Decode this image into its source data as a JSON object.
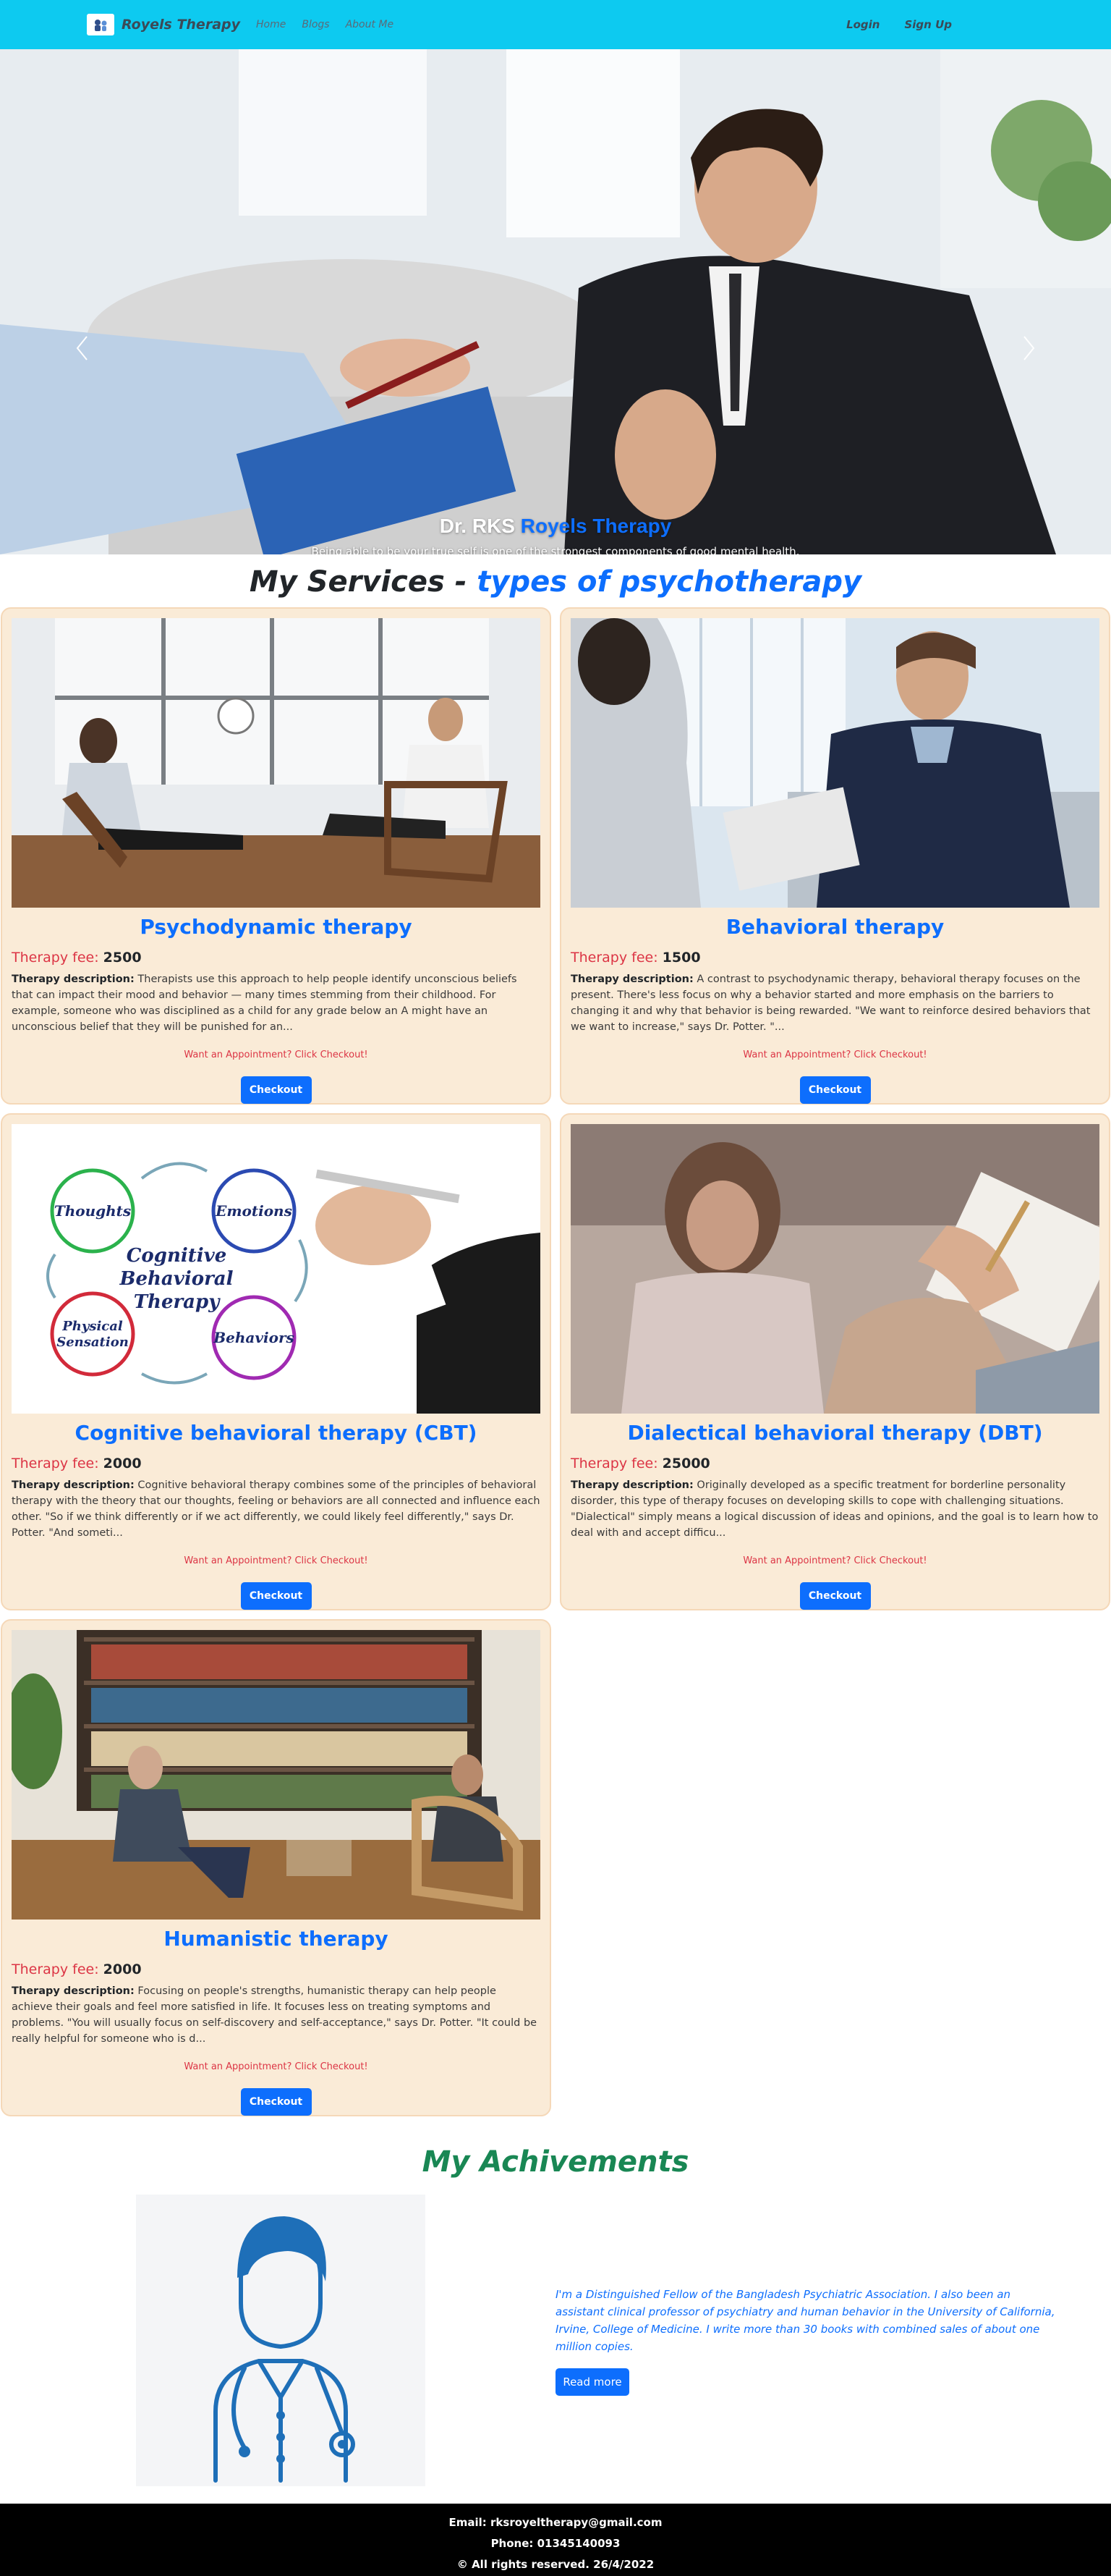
{
  "navbar": {
    "brand": "Royels Therapy",
    "links": [
      "Home",
      "Blogs",
      "About Me"
    ],
    "login": "Login",
    "signup": "Sign Up"
  },
  "carousel": {
    "caption_prefix": "Dr. RKS",
    "caption_accent": "Royels Therapy",
    "caption_text": "Being able to be your true self is one of the strongest components of good mental health.",
    "prev_icon": "chevron-left-icon",
    "next_icon": "chevron-right-icon",
    "active_slide": 2,
    "slide_count": 3
  },
  "services": {
    "title": "My Services -",
    "title_accent": "types of psychotherapy",
    "fee_label": "Therapy fee:",
    "desc_label": "Therapy description:",
    "appointment_text": "Want an Appointment? Click Checkout!",
    "checkout_label": "Checkout",
    "items": [
      {
        "title": "Psychodynamic therapy",
        "fee": "2500",
        "description": "Therapists use this approach to help people identify unconscious beliefs that can impact their mood and behavior — many times stemming from their childhood. For example, someone who was disciplined as a child for any grade below an A might have an unconscious belief that they will be punished for an..."
      },
      {
        "title": "Behavioral therapy",
        "fee": "1500",
        "description": "A contrast to psychodynamic therapy, behavioral therapy focuses on the present. There's less focus on why a behavior started and more emphasis on the barriers to changing it and why that behavior is being rewarded. \"We want to reinforce desired behaviors that we want to increase,\" says Dr. Potter. \"..."
      },
      {
        "title": "Cognitive behavioral therapy (CBT)",
        "fee": "2000",
        "description": "Cognitive behavioral therapy combines some of the principles of behavioral therapy with the theory that our thoughts, feeling or behaviors are all connected and influence each other. \"So if we think differently or if we act differently, we could likely feel differently,\" says Dr. Potter. \"And someti..."
      },
      {
        "title": "Dialectical behavioral therapy (DBT)",
        "fee": "25000",
        "description": "Originally developed as a specific treatment for borderline personality disorder, this type of therapy focuses on developing skills to cope with challenging situations. \"Dialectical\" simply means a logical discussion of ideas and opinions, and the goal is to learn how to deal with and accept difficu..."
      },
      {
        "title": "Humanistic therapy",
        "fee": "2000",
        "description": "Focusing on people's strengths, humanistic therapy can help people achieve their goals and feel more satisfied in life. It focuses less on treating symptoms and problems. \"You will usually focus on self-discovery and self-acceptance,\" says Dr. Potter. \"It could be really helpful for someone who is d..."
      }
    ],
    "cbt_diagram": {
      "thoughts": "Thoughts",
      "emotions": "Emotions",
      "behaviors": "Behaviors",
      "physical_1": "Physical",
      "physical_2": "Sensation",
      "center_1": "Cognitive",
      "center_2": "Behavioral",
      "center_3": "Therapy"
    }
  },
  "achievements": {
    "title": "My Achivements",
    "text": "I'm a Distinguished Fellow of the Bangladesh Psychiatric Association. I also been an assistant clinical professor of psychiatry and human behavior in the University of California, Irvine, College of Medicine. I write more than 30 books with combined sales of about one million copies.",
    "read_more": "Read more"
  },
  "footer": {
    "email": "Email: rksroyeltherapy@gmail.com",
    "phone": "Phone: 01345140093",
    "rights": "© All rights reserved. 26/4/2022"
  },
  "colors": {
    "navbar": "#0dcaf0",
    "card_bg": "#faebd7",
    "primary": "#0d6efd",
    "danger": "#dc3545",
    "success": "#198754"
  }
}
